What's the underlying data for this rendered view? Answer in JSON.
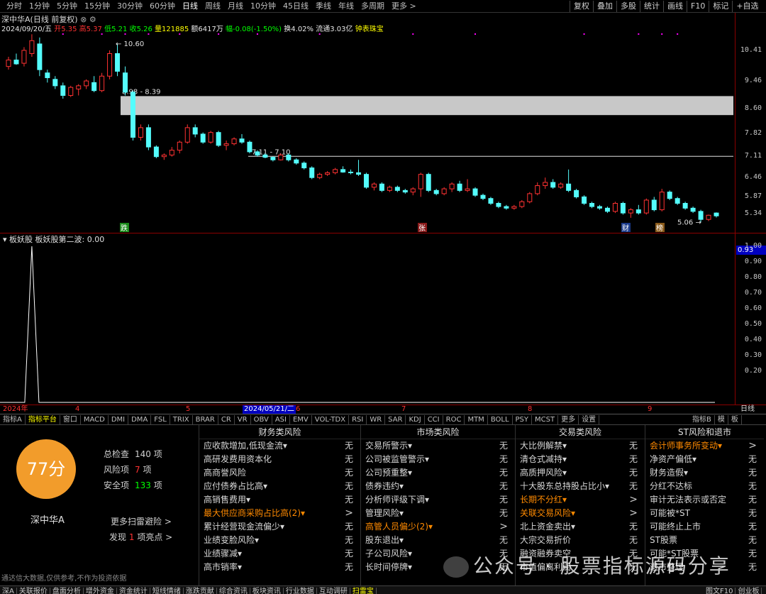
{
  "toolbar": {
    "periods": [
      "分时",
      "1分钟",
      "5分钟",
      "15分钟",
      "30分钟",
      "60分钟",
      "日线",
      "周线",
      "月线",
      "10分钟",
      "45日线",
      "季线",
      "年线",
      "多周期",
      "更多 >"
    ],
    "active_period": "日线",
    "tools": [
      "复权",
      "叠加",
      "多股",
      "统计",
      "画线",
      "F10",
      "标记",
      "+自选"
    ]
  },
  "title": {
    "stock": "深中华A(日线 前复权)",
    "date": "2024/09/20/五",
    "open_label": "开",
    "open": "5.35",
    "high_label": "高",
    "high": "5.37",
    "low_label": "低",
    "low": "5.21",
    "close_label": "收",
    "close": "5.26",
    "vol_label": "量",
    "vol": "121885",
    "amt_label": "额",
    "amt": "6417万",
    "chg_label": "幅",
    "chg": "-0.08(-1.50%)",
    "turnover": "换4.02%",
    "float": "流通3.03亿",
    "concept": "钟表珠宝"
  },
  "price_axis": [
    "10.41",
    "9.46",
    "8.60",
    "7.82",
    "7.11",
    "6.46",
    "5.87",
    "5.34"
  ],
  "annotations": {
    "high": "10.60",
    "zone1": "8.98 - 8.39",
    "zone2": "7.11 - 7.10",
    "low": "5.06",
    "markers": [
      "跌",
      "张",
      "财",
      "榜"
    ]
  },
  "indicator": {
    "title": "板妖股  板妖股第二波: 0.00",
    "current": "0.93",
    "axis": [
      "1.00",
      "0.90",
      "0.80",
      "0.70",
      "0.60",
      "0.50",
      "0.40",
      "0.30",
      "0.20"
    ]
  },
  "date_axis": [
    "2024年",
    "4",
    "2024/05/21/二",
    "5",
    "6",
    "7",
    "8",
    "9"
  ],
  "date_axis_right": "日线",
  "tabs": [
    "指标A",
    "指标平台",
    "窗口",
    "MACD",
    "DMI",
    "DMA",
    "FSL",
    "TRIX",
    "BRAR",
    "CR",
    "VR",
    "OBV",
    "ASI",
    "EMV",
    "VOL-TDX",
    "RSI",
    "WR",
    "SAR",
    "KDJ",
    "CCI",
    "ROC",
    "MTM",
    "BOLL",
    "PSY",
    "MCST",
    "更多",
    "设置"
  ],
  "tabs_right": [
    "指标B",
    "模",
    "板"
  ],
  "active_tab": "指标平台",
  "scan": {
    "score": "77分",
    "name": "深中华A",
    "total_label": "总检查",
    "total": "140",
    "total_unit": "项",
    "risk_label": "风险项",
    "risk": "7",
    "risk_unit": "项",
    "safe_label": "安全项",
    "safe": "133",
    "safe_unit": "项",
    "more_link": "更多扫雷避险 >",
    "find_prefix": "发现",
    "find_count": "1",
    "find_suffix": "项亮点 >",
    "disclaimer": "通达信大数据,仅供参考,不作为投资依据",
    "columns": [
      {
        "title": "财务类风险",
        "rows": [
          {
            "label": "应收款增加,低现金流▾",
            "value": "无"
          },
          {
            "label": "高研发费用资本化",
            "value": "无"
          },
          {
            "label": "高商誉风险",
            "value": "无"
          },
          {
            "label": "应付债券占比高▾",
            "value": "无"
          },
          {
            "label": "高销售费用▾",
            "value": "无"
          },
          {
            "label": "最大供应商采购占比高(2)▾",
            "value": ">",
            "hl": true
          },
          {
            "label": "累计经营现金流偏少▾",
            "value": "无"
          },
          {
            "label": "业绩变脸风险▾",
            "value": "无"
          },
          {
            "label": "业绩骤减▾",
            "value": "无"
          },
          {
            "label": "高市销率▾",
            "value": "无"
          }
        ]
      },
      {
        "title": "市场类风险",
        "rows": [
          {
            "label": "交易所警示▾",
            "value": "无"
          },
          {
            "label": "公司被监管警示▾",
            "value": "无"
          },
          {
            "label": "公司预重整▾",
            "value": "无"
          },
          {
            "label": "债券违约▾",
            "value": "无"
          },
          {
            "label": "分析师评级下调▾",
            "value": "无"
          },
          {
            "label": "管理风险▾",
            "value": "无"
          },
          {
            "label": "高管人员偏少(2)▾",
            "value": ">",
            "hl": true
          },
          {
            "label": "股东退出▾",
            "value": "无"
          },
          {
            "label": "子公司风险▾",
            "value": "无"
          },
          {
            "label": "长时间停牌▾",
            "value": "无"
          }
        ]
      },
      {
        "title": "交易类风险",
        "rows": [
          {
            "label": "大比例解禁▾",
            "value": "无"
          },
          {
            "label": "清仓式减持▾",
            "value": "无"
          },
          {
            "label": "高质押风险▾",
            "value": "无"
          },
          {
            "label": "十大股东总持股占比小▾",
            "value": "无"
          },
          {
            "label": "长期不分红▾",
            "value": ">",
            "hl": true
          },
          {
            "label": "关联交易风险▾",
            "value": ">",
            "hl": true
          },
          {
            "label": "北上资金卖出▾",
            "value": "无"
          },
          {
            "label": "大宗交易折价",
            "value": "无"
          },
          {
            "label": "融资融券卖空",
            "value": "无"
          },
          {
            "label": "市值偏离利润",
            "value": "无"
          }
        ]
      },
      {
        "title": "ST风险和退市",
        "rows": [
          {
            "label": "会计师事务所变动▾",
            "value": ">",
            "hl": true
          },
          {
            "label": "净资产偏低▾",
            "value": "无"
          },
          {
            "label": "财务造假▾",
            "value": "无"
          },
          {
            "label": "分红不达标",
            "value": "无"
          },
          {
            "label": "审计无法表示或否定",
            "value": "无"
          },
          {
            "label": "可能被*ST",
            "value": "无"
          },
          {
            "label": "可能终止上市",
            "value": "无"
          },
          {
            "label": "ST股票",
            "value": "无"
          },
          {
            "label": "可能*ST股票",
            "value": "无"
          },
          {
            "label": "退市整理",
            "value": "无"
          }
        ]
      }
    ]
  },
  "watermark": "公众号 · 股票指标源码分享",
  "statusbar": [
    "深A",
    "关联报价",
    "盘面分析",
    "增外资金",
    "资金统计",
    "短线情绪",
    "涨跌贡献",
    "综合资讯",
    "板块资讯",
    "行业数据",
    "互动调研",
    "扫雷宝"
  ],
  "statusbar_right": [
    "图文F10",
    "创业板"
  ],
  "colors": {
    "up": "#ff3232",
    "down": "#54fcfc",
    "zone": "#c8c8c8",
    "score": "#f29c2b",
    "highlight": "#ff8a00"
  },
  "candles": [
    [
      9.9,
      10.2,
      9.8,
      10.1
    ],
    [
      10.1,
      10.3,
      9.95,
      9.98
    ],
    [
      10.0,
      10.5,
      9.9,
      10.4
    ],
    [
      10.3,
      10.9,
      10.2,
      10.7
    ],
    [
      10.6,
      10.8,
      9.6,
      9.8
    ],
    [
      9.7,
      9.8,
      9.4,
      9.55
    ],
    [
      9.5,
      9.6,
      9.2,
      9.3
    ],
    [
      9.3,
      9.4,
      8.9,
      9.0
    ],
    [
      9.0,
      9.3,
      8.95,
      9.25
    ],
    [
      9.2,
      9.35,
      9.0,
      9.3
    ],
    [
      9.3,
      9.5,
      9.2,
      9.45
    ],
    [
      9.4,
      9.6,
      9.1,
      9.15
    ],
    [
      9.15,
      9.7,
      9.1,
      9.6
    ],
    [
      9.6,
      10.4,
      9.5,
      10.3
    ],
    [
      10.3,
      10.6,
      9.6,
      9.75
    ],
    [
      9.7,
      9.9,
      9.0,
      9.1
    ],
    [
      9.1,
      9.15,
      7.6,
      7.7
    ],
    [
      7.7,
      8.1,
      7.6,
      8.0
    ],
    [
      8.0,
      8.1,
      7.3,
      7.4
    ],
    [
      7.4,
      7.45,
      7.05,
      7.1
    ],
    [
      7.1,
      7.2,
      7.0,
      7.15
    ],
    [
      7.15,
      7.4,
      7.1,
      7.3
    ],
    [
      7.3,
      7.6,
      7.2,
      7.55
    ],
    [
      7.55,
      8.1,
      7.5,
      8.0
    ],
    [
      8.0,
      8.1,
      7.7,
      7.8
    ],
    [
      7.8,
      7.85,
      7.5,
      7.55
    ],
    [
      7.55,
      7.9,
      7.5,
      7.85
    ],
    [
      7.85,
      7.9,
      7.4,
      7.45
    ],
    [
      7.45,
      7.6,
      7.3,
      7.5
    ],
    [
      7.5,
      7.7,
      7.45,
      7.65
    ],
    [
      7.65,
      7.8,
      7.5,
      7.55
    ],
    [
      7.55,
      7.6,
      7.2,
      7.25
    ],
    [
      7.25,
      7.3,
      7.1,
      7.15
    ],
    [
      7.15,
      7.2,
      7.05,
      7.08
    ],
    [
      7.08,
      7.1,
      6.95,
      7.0
    ],
    [
      7.0,
      7.2,
      6.98,
      7.15
    ],
    [
      7.15,
      7.2,
      6.95,
      7.0
    ],
    [
      7.0,
      7.05,
      6.85,
      6.9
    ],
    [
      6.9,
      6.95,
      6.7,
      6.75
    ],
    [
      6.75,
      6.8,
      6.4,
      6.45
    ],
    [
      6.45,
      6.6,
      6.4,
      6.55
    ],
    [
      6.55,
      6.65,
      6.5,
      6.6
    ],
    [
      6.6,
      6.75,
      6.55,
      6.7
    ],
    [
      6.7,
      6.8,
      6.6,
      6.62
    ],
    [
      6.62,
      6.7,
      6.55,
      6.6
    ],
    [
      6.6,
      7.0,
      6.5,
      6.55
    ],
    [
      6.55,
      6.6,
      6.1,
      6.15
    ],
    [
      6.15,
      6.3,
      6.05,
      6.25
    ],
    [
      6.25,
      6.3,
      6.0,
      6.05
    ],
    [
      6.05,
      6.2,
      6.0,
      6.15
    ],
    [
      6.15,
      6.2,
      6.0,
      6.05
    ],
    [
      6.05,
      6.1,
      5.95,
      6.0
    ],
    [
      6.0,
      6.15,
      5.9,
      6.1
    ],
    [
      6.1,
      6.6,
      5.85,
      6.55
    ],
    [
      6.55,
      6.6,
      6.0,
      6.05
    ],
    [
      6.05,
      6.1,
      5.9,
      5.95
    ],
    [
      5.95,
      6.15,
      5.9,
      6.1
    ],
    [
      6.1,
      6.3,
      6.0,
      6.25
    ],
    [
      6.25,
      6.35,
      6.0,
      6.05
    ],
    [
      6.05,
      6.4,
      6.0,
      6.1
    ],
    [
      6.1,
      6.15,
      5.85,
      5.9
    ],
    [
      5.9,
      5.95,
      5.75,
      5.8
    ],
    [
      5.8,
      5.85,
      5.6,
      5.65
    ],
    [
      5.65,
      5.7,
      5.5,
      5.55
    ],
    [
      5.55,
      5.6,
      5.45,
      5.5
    ],
    [
      5.5,
      5.6,
      5.45,
      5.55
    ],
    [
      5.55,
      5.75,
      5.5,
      5.7
    ],
    [
      5.7,
      6.0,
      5.65,
      5.95
    ],
    [
      5.95,
      6.3,
      5.9,
      6.2
    ],
    [
      6.2,
      6.45,
      6.1,
      6.3
    ],
    [
      6.3,
      6.4,
      6.1,
      6.15
    ],
    [
      6.15,
      6.3,
      6.1,
      6.25
    ],
    [
      6.25,
      6.7,
      6.0,
      6.05
    ],
    [
      6.05,
      6.1,
      5.8,
      5.85
    ],
    [
      5.85,
      5.9,
      5.6,
      5.65
    ],
    [
      5.65,
      5.7,
      5.5,
      5.55
    ],
    [
      5.55,
      5.6,
      5.45,
      5.5
    ],
    [
      5.5,
      5.55,
      5.35,
      5.4
    ],
    [
      5.4,
      5.7,
      5.35,
      5.65
    ],
    [
      5.65,
      5.7,
      5.3,
      5.35
    ],
    [
      5.35,
      5.5,
      5.2,
      5.45
    ],
    [
      5.45,
      5.6,
      5.3,
      5.35
    ],
    [
      5.35,
      5.8,
      5.3,
      5.75
    ],
    [
      5.75,
      5.85,
      5.4,
      5.45
    ],
    [
      5.45,
      6.1,
      5.4,
      6.0
    ],
    [
      6.0,
      6.05,
      5.75,
      5.8
    ],
    [
      5.8,
      5.85,
      5.6,
      5.65
    ],
    [
      5.65,
      5.7,
      5.45,
      5.5
    ],
    [
      5.5,
      5.55,
      5.35,
      5.4
    ],
    [
      5.4,
      5.45,
      5.06,
      5.15
    ],
    [
      5.15,
      5.3,
      5.1,
      5.28
    ],
    [
      5.35,
      5.37,
      5.21,
      5.26
    ]
  ],
  "indicator_series_peak_index": 3
}
